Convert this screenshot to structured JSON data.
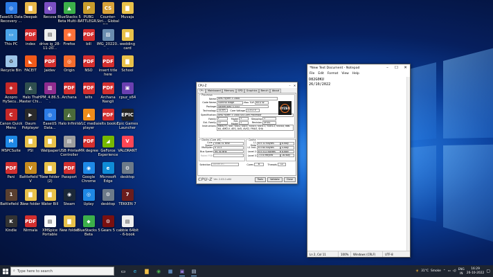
{
  "desktop_icons": [
    {
      "label": "EaseUS Data Recovery ...",
      "color": "#2c7be5",
      "glyph": "◎"
    },
    {
      "label": "Deepak",
      "color": "#e8b84a",
      "glyph": "▇"
    },
    {
      "label": "Recuva",
      "color": "#7a4fc2",
      "glyph": "◐"
    },
    {
      "label": "BlueStacks 5 Beta Multi-...",
      "color": "#3cb04a",
      "glyph": "▲"
    },
    {
      "label": "PUBG BATTLEGR...",
      "color": "#c89c2c",
      "glyph": "P"
    },
    {
      "label": "Counter-Stri... Global Offe...",
      "color": "#d8a23a",
      "glyph": "CS"
    },
    {
      "label": "Muvaja",
      "color": "#e8c14a",
      "glyph": "▇"
    },
    {
      "label": "This PC",
      "color": "#4aa3e8",
      "glyph": "▭"
    },
    {
      "label": "index",
      "color": "#d32f2f",
      "glyph": "PDF"
    },
    {
      "label": "drive ig_28-11-20...",
      "color": "#eeeeee",
      "glyph": "▤"
    },
    {
      "label": "Firefox",
      "color": "#ff7139",
      "glyph": "◉"
    },
    {
      "label": "bill",
      "color": "#d32f2f",
      "glyph": "PDF"
    },
    {
      "label": "IMG_20220...",
      "color": "#6a8caf",
      "glyph": "▨"
    },
    {
      "label": "wedding card",
      "color": "#e8c14a",
      "glyph": "▇"
    },
    {
      "label": "Recycle Bin",
      "color": "#9ec6e8",
      "glyph": "♻"
    },
    {
      "label": "FACEIT",
      "color": "#f25a1a",
      "glyph": "◣"
    },
    {
      "label": "Jaidev",
      "color": "#d32f2f",
      "glyph": "PDF"
    },
    {
      "label": "Origin",
      "color": "#f56c2d",
      "glyph": "◎"
    },
    {
      "label": "NSO",
      "color": "#d32f2f",
      "glyph": "PDF"
    },
    {
      "label": "insert title here",
      "color": "#d32f2f",
      "glyph": "PDF"
    },
    {
      "label": "School",
      "color": "#e8c14a",
      "glyph": "▇"
    },
    {
      "label": "Acopro HySecu...",
      "color": "#c62828",
      "glyph": "◈"
    },
    {
      "label": "Halo The Master Chi...",
      "color": "#2f4f4f",
      "glyph": "◭"
    },
    {
      "label": "HPM_4.86.5...",
      "color": "#8e2b8e",
      "glyph": "▥"
    },
    {
      "label": "Archana",
      "color": "#d32f2f",
      "glyph": "PDF"
    },
    {
      "label": "ielts",
      "color": "#d32f2f",
      "glyph": "PDF"
    },
    {
      "label": "Archana Nangli",
      "color": "#d32f2f",
      "glyph": "PDF"
    },
    {
      "label": "cpuz_x64",
      "color": "#6a3fb0",
      "glyph": "▣"
    },
    {
      "label": "Canon Quick Menu",
      "color": "#c62828",
      "glyph": "C"
    },
    {
      "label": "Daum Potplayer",
      "color": "#2a2a2a",
      "glyph": "▶"
    },
    {
      "label": "EaseUS Data...",
      "color": "#2c7be5",
      "glyph": "◎"
    },
    {
      "label": "Halo Infinite",
      "color": "#4b6b3a",
      "glyph": "◭"
    },
    {
      "label": "VLC media player",
      "color": "#f08c1a",
      "glyph": "▲"
    },
    {
      "label": "ielts books",
      "color": "#d32f2f",
      "glyph": "PDF"
    },
    {
      "label": "Epic Games Launcher",
      "color": "#222222",
      "glyph": "EPIC"
    },
    {
      "label": "MSPCSuite",
      "color": "#1e88e5",
      "glyph": "M"
    },
    {
      "label": "PSI",
      "color": "#e8c14a",
      "glyph": "▇"
    },
    {
      "label": "Wallpaper",
      "color": "#e8c14a",
      "glyph": "▇"
    },
    {
      "label": "USB Printer Controller",
      "color": "#9e9e9e",
      "glyph": "▤"
    },
    {
      "label": "MR degree",
      "color": "#d32f2f",
      "glyph": "PDF"
    },
    {
      "label": "GeForce Experience",
      "color": "#76b900",
      "glyph": "◢"
    },
    {
      "label": "VALORANT",
      "color": "#ff4655",
      "glyph": "V"
    },
    {
      "label": "Pani",
      "color": "#d32f2f",
      "glyph": "PDF"
    },
    {
      "label": "Battlefield™ V",
      "color": "#c68a1e",
      "glyph": "V"
    },
    {
      "label": "New folder (2)",
      "color": "#e8c14a",
      "glyph": "▇"
    },
    {
      "label": "Passport",
      "color": "#d32f2f",
      "glyph": "PDF"
    },
    {
      "label": "Google Chrome",
      "color": "#1e88e5",
      "glyph": "◉"
    },
    {
      "label": "Microsoft Edge",
      "color": "#0f8bd6",
      "glyph": "e"
    },
    {
      "label": "desktop",
      "color": "#6c7a89",
      "glyph": "⚙"
    },
    {
      "label": "Battlefield 1",
      "color": "#5a4030",
      "glyph": "1"
    },
    {
      "label": "New folder",
      "color": "#e8c14a",
      "glyph": "▇"
    },
    {
      "label": "Water Bill",
      "color": "#e8c14a",
      "glyph": "▇"
    },
    {
      "label": "Steam",
      "color": "#1b2838",
      "glyph": "◉"
    },
    {
      "label": "Uplay",
      "color": "#1e88e5",
      "glyph": "◎"
    },
    {
      "label": "desktop",
      "color": "#6c7a89",
      "glyph": "⚙"
    },
    {
      "label": "TEKKEN 7",
      "color": "#6b1d1d",
      "glyph": "7"
    },
    {
      "label": "Kindle",
      "color": "#333333",
      "glyph": "K"
    },
    {
      "label": "Nirmala",
      "color": "#d32f2f",
      "glyph": "PDF"
    },
    {
      "label": "XMSpice Portable",
      "color": "#fafafa",
      "glyph": "▤"
    },
    {
      "label": "New folder",
      "color": "#e8c14a",
      "glyph": "▇"
    },
    {
      "label": "BlueStacks 5 Beta",
      "color": "#3cb04a",
      "glyph": "◆"
    },
    {
      "label": "Gears 5",
      "color": "#7a1010",
      "glyph": "⚙"
    },
    {
      "label": "cabbie 64bit - 6-book ma...",
      "color": "#eeeeee",
      "glyph": "▤"
    }
  ],
  "cpuz": {
    "title": "CPU-Z",
    "tabs": [
      "CPU",
      "Mainboard",
      "Memory",
      "SPD",
      "Graphics",
      "Bench",
      "About"
    ],
    "processor_title": "Processor",
    "name_label": "Name",
    "name": "AMD Ryzen 5 1600",
    "codename_label": "Code Name",
    "codename": "Summit Ridge",
    "maxtdp_label": "Max TDP",
    "maxtdp": "65.0 W",
    "package_label": "Package",
    "package": "Socket AM4 (1331)",
    "tech_label": "Technology",
    "tech": "14 nm",
    "corevolt_label": "Core Voltage",
    "corevolt": "1.372 V",
    "spec_label": "Specification",
    "spec": "AMD Ryzen 5 1600 Six-Core Processor",
    "family_label": "Family",
    "family": "F",
    "model_label": "Model",
    "model": "1",
    "stepping_label": "Stepping",
    "stepping": "1",
    "extfamily_label": "Ext. Family",
    "extfamily": "17",
    "extmodel_label": "Ext. Model",
    "extmodel": "1",
    "revision_label": "Revision",
    "revision": "ZP-B1",
    "instr_label": "Instructions",
    "instr": "MMX(+), SSE, SSE2, SSE3, SSSE3, SSE4.1, SSE4.2, SSE4A, x86-64, AMD-V, AES, AVX, AVX2, FMA3, SHA",
    "clocks_title": "Clocks (Core #0)",
    "corespeed_label": "Core Speed",
    "corespeed": "1546.31 MHz",
    "mult_label": "Multiplier",
    "mult": "x 15.5",
    "bus_label": "Bus Speed",
    "bus": "99.76 MHz",
    "fsb_label": "Rated FSB",
    "fsb": "",
    "cache_title": "Cache",
    "l1d_label": "L1 Data",
    "l1d": "6 x 32 KBytes",
    "l1d_way": "8-way",
    "l1i_label": "L1 Inst.",
    "l1i": "6 x 64 KBytes",
    "l1i_way": "4-way",
    "l2_label": "Level 2",
    "l2": "6 x 512 KBytes",
    "l2_way": "8-way",
    "l3_label": "Level 3",
    "l3": "2 x 8 MBytes",
    "l3_way": "16-way",
    "selection_label": "Selection",
    "selection": "Socket #1",
    "cores_label": "Cores",
    "cores": "6",
    "threads_label": "Threads",
    "threads": "12",
    "logo": "CPU-Z",
    "version": "Ver. 2.03.0.x64",
    "tools_btn": "Tools",
    "validate_btn": "Validate",
    "close_btn": "Close",
    "ryzen_logo": "RYZEN"
  },
  "notepad": {
    "title": "*New Text Document - Notepad",
    "menu": [
      "File",
      "Edit",
      "Format",
      "View",
      "Help"
    ],
    "content": "D82G0KU\n26/10/2022",
    "status_pos": "Ln 2, Col 11",
    "status_zoom": "100%",
    "status_eol": "Windows (CRLF)",
    "status_enc": "UTF-8"
  },
  "taskbar": {
    "search_placeholder": "Type here to search",
    "weather_temp": "31°C",
    "weather_text": "Smoke",
    "lang1": "ENG",
    "lang2": "IN",
    "time": "16:29",
    "date": "26-10-2022"
  }
}
